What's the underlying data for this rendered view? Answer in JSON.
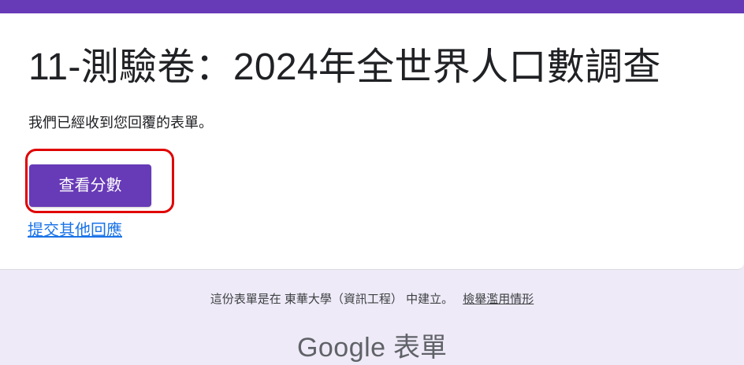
{
  "theme": {
    "accent": "#673ab7",
    "highlight": "#e00000",
    "link": "#1a73e8",
    "page_background": "#efeaf7"
  },
  "form": {
    "title": "11-測驗卷：2024年全世界人口數調查",
    "confirmation_message": "我們已經收到您回覆的表單。",
    "view_score_label": "查看分數",
    "submit_another_label": "提交其他回應"
  },
  "footer": {
    "created_in_text": "這份表單是在 東華大學（資訊工程） 中建立。",
    "report_abuse_label": "檢舉濫用情形",
    "brand_logo": "Google",
    "brand_product": "表單"
  }
}
